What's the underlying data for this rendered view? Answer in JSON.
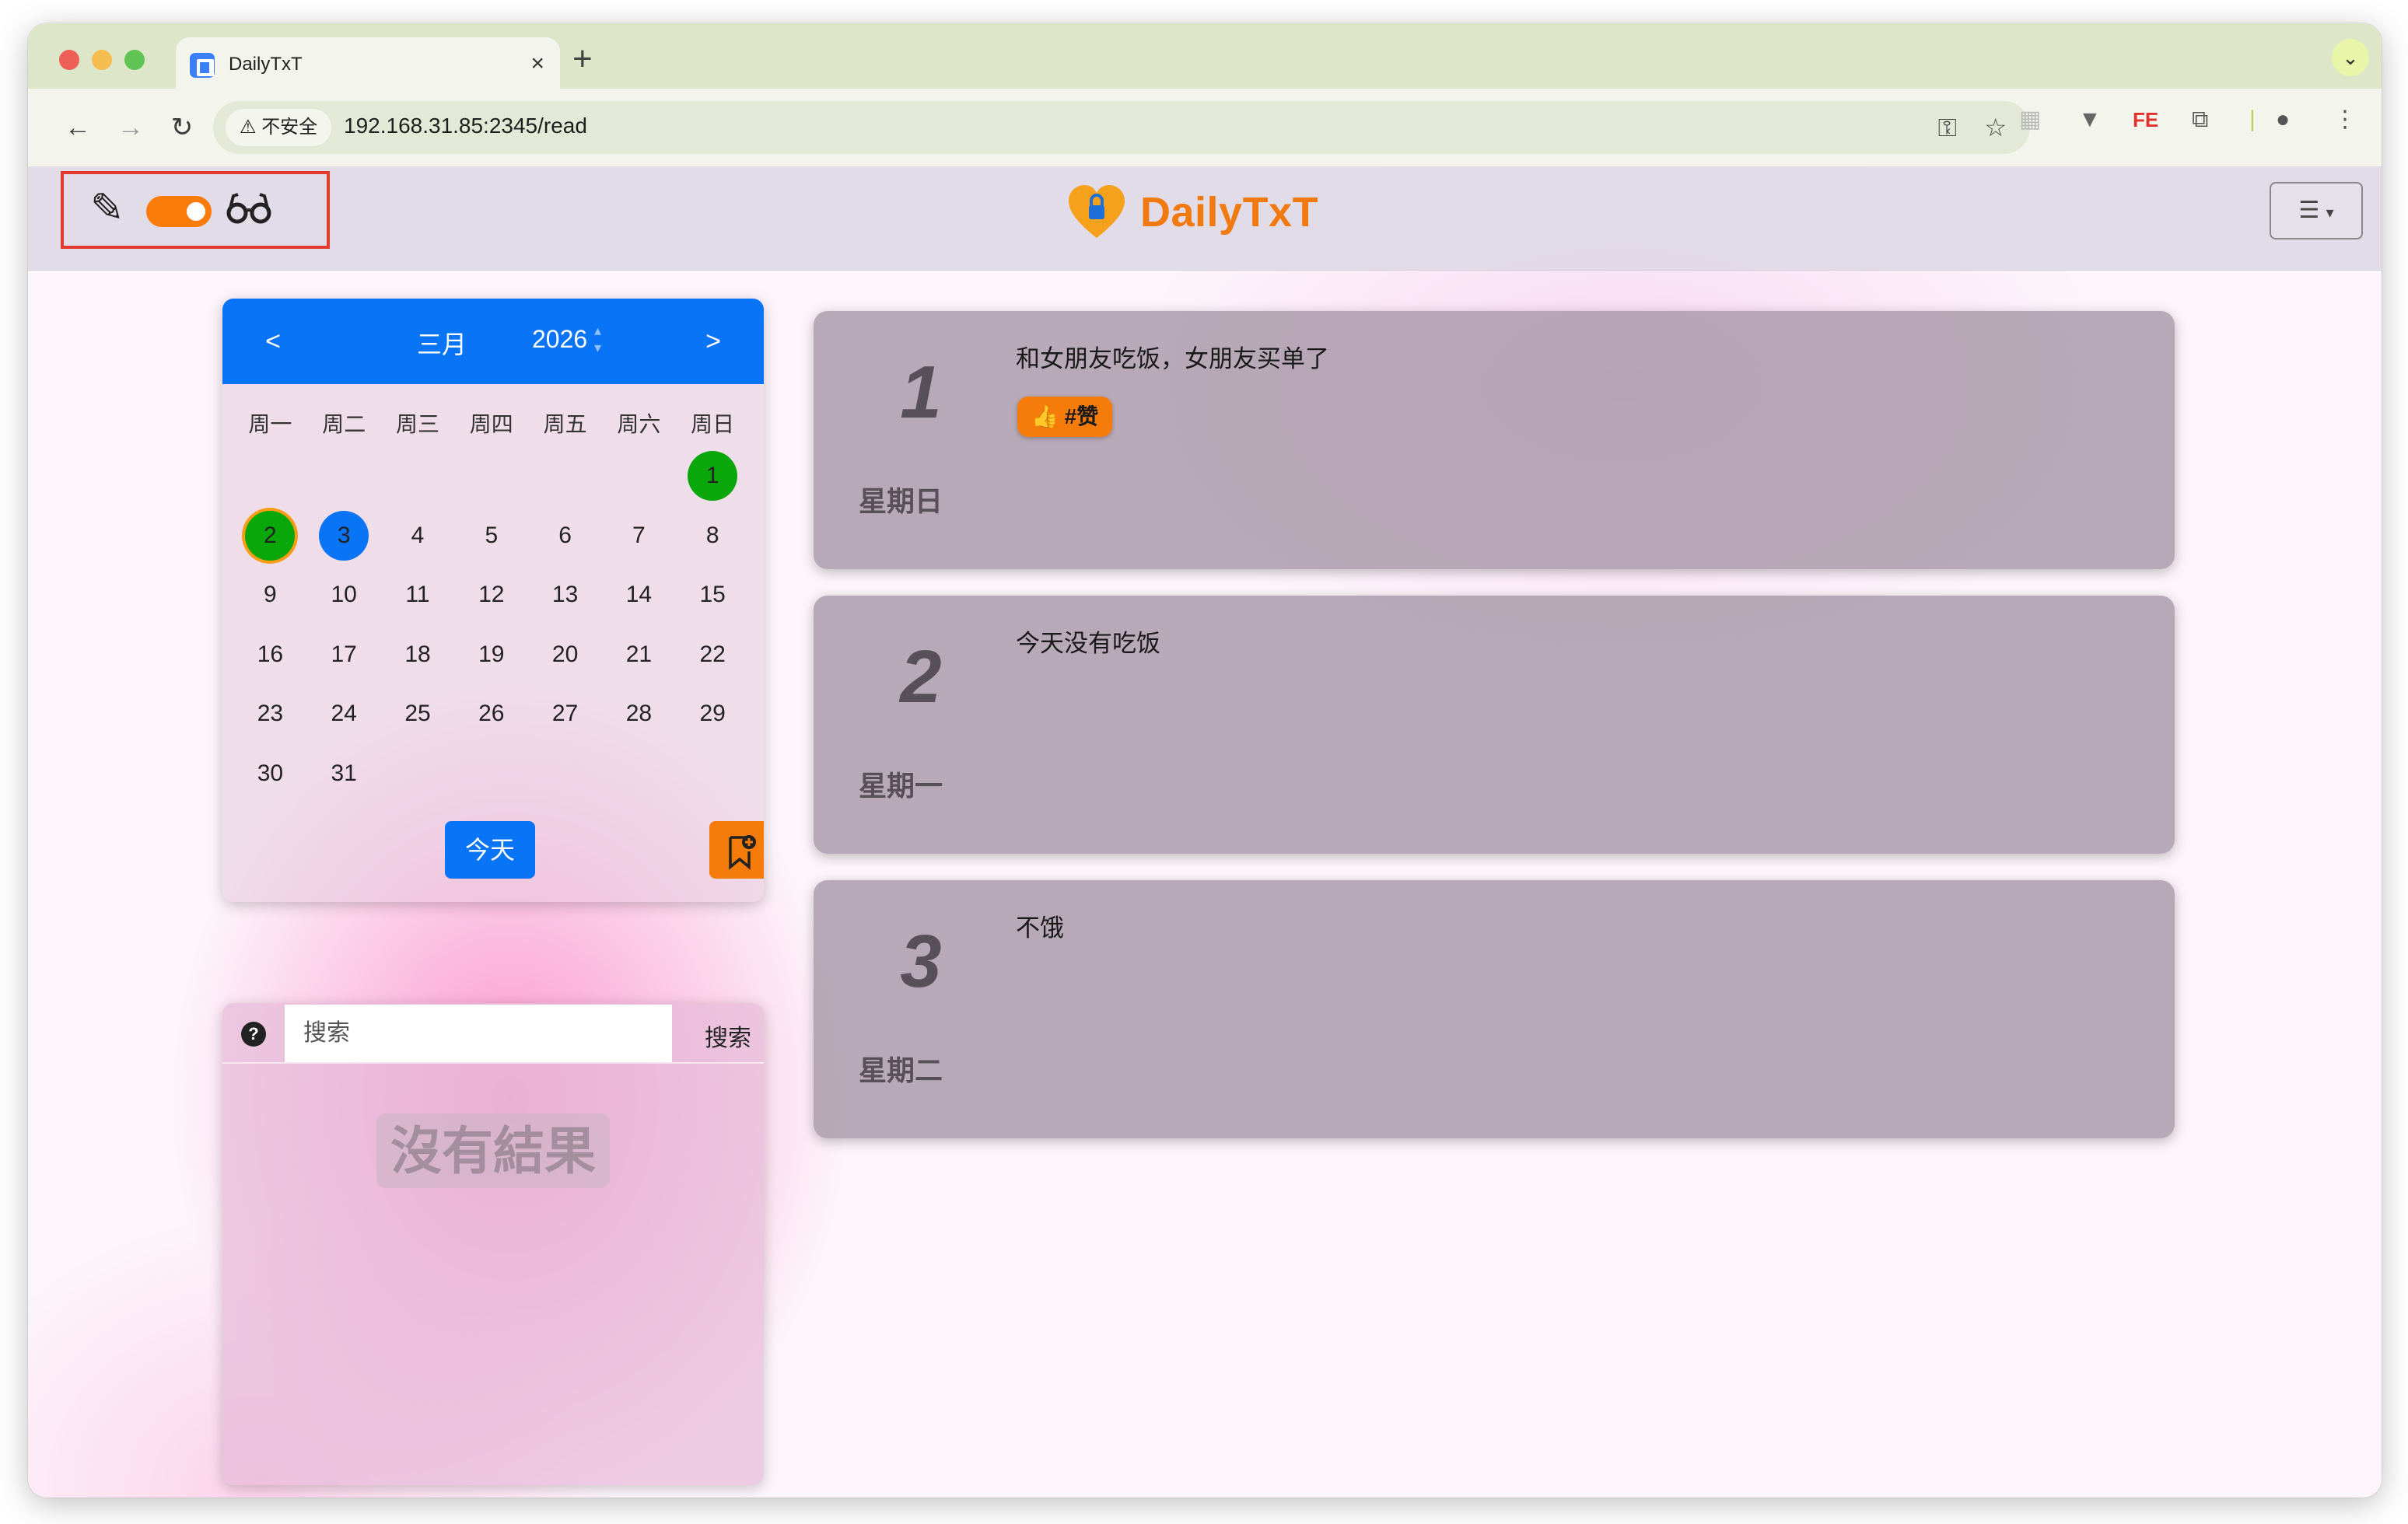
{
  "browser": {
    "tab_title": "DailyTxT",
    "tab_close": "×",
    "new_tab": "+",
    "insecure_label": "不安全",
    "url": "192.168.31.85:2345/read"
  },
  "app": {
    "brand": "DailyTxT",
    "colors": {
      "accent": "#f57c0a",
      "primary": "#0a74f6",
      "marked_day": "#0aa70a"
    }
  },
  "calendar": {
    "prev": "<",
    "next": ">",
    "month": "三月",
    "year": "2026",
    "weekdays": [
      "周一",
      "周二",
      "周三",
      "周四",
      "周五",
      "周六",
      "周日"
    ],
    "days": [
      "1",
      "2",
      "3",
      "4",
      "5",
      "6",
      "7",
      "8",
      "9",
      "10",
      "11",
      "12",
      "13",
      "14",
      "15",
      "16",
      "17",
      "18",
      "19",
      "20",
      "21",
      "22",
      "23",
      "24",
      "25",
      "26",
      "27",
      "28",
      "29",
      "30",
      "31"
    ],
    "today_label": "今天"
  },
  "search": {
    "placeholder": "搜索",
    "button": "搜索",
    "help": "?",
    "no_results": "沒有結果"
  },
  "entries": [
    {
      "day": "1",
      "weekday": "星期日",
      "text": "和女朋友吃饭，女朋友买单了",
      "tag": "👍 #赞"
    },
    {
      "day": "2",
      "weekday": "星期一",
      "text": "今天没有吃饭"
    },
    {
      "day": "3",
      "weekday": "星期二",
      "text": "不饿"
    }
  ]
}
